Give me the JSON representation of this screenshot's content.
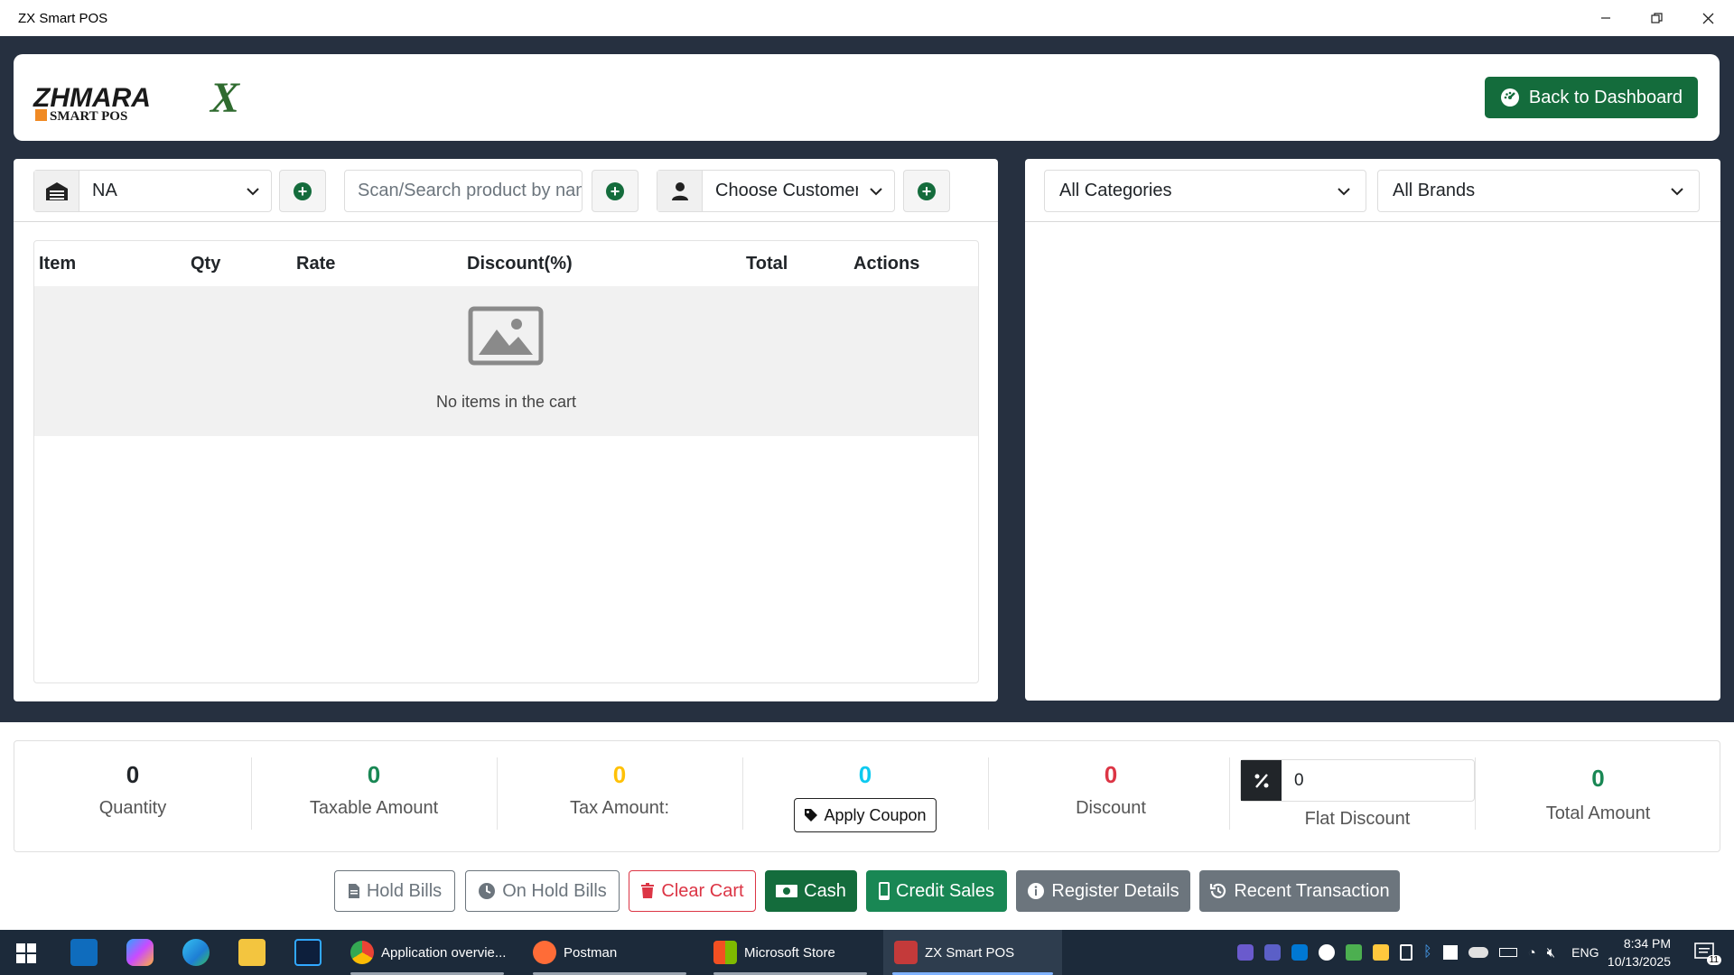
{
  "window": {
    "title": "ZX Smart POS"
  },
  "header": {
    "logo_main": "ZHMARA",
    "logo_x": "X",
    "logo_sub": "SMART POS",
    "dashboard_label": "Back to Dashboard"
  },
  "left": {
    "warehouse_value": "NA",
    "search_placeholder": "Scan/Search product by name",
    "customer_value": "Choose Customer",
    "columns": [
      "Item",
      "Qty",
      "Rate",
      "Discount(%)",
      "Total",
      "Actions"
    ],
    "empty_text": "No items in the cart"
  },
  "right": {
    "category_value": "All Categories",
    "brand_value": "All Brands"
  },
  "summary": {
    "quantity": {
      "value": "0",
      "label": "Quantity"
    },
    "taxable": {
      "value": "0",
      "label": "Taxable Amount"
    },
    "tax": {
      "value": "0",
      "label": "Tax Amount:"
    },
    "coupon": {
      "value": "0",
      "button": "Apply Coupon"
    },
    "discount": {
      "value": "0",
      "label": "Discount"
    },
    "flat": {
      "value": "0",
      "label": "Flat Discount"
    },
    "total": {
      "value": "0",
      "label": "Total Amount"
    }
  },
  "actions": {
    "hold": "Hold Bills",
    "onhold": "On Hold Bills",
    "clear": "Clear Cart",
    "cash": "Cash",
    "credit": "Credit Sales",
    "register": "Register Details",
    "recent": "Recent Transaction"
  },
  "taskbar": {
    "apps": [
      {
        "label": "Application overvie..."
      },
      {
        "label": "Postman"
      },
      {
        "label": "Microsoft Store"
      },
      {
        "label": "ZX Smart POS"
      }
    ],
    "lang": "ENG",
    "time": "8:34 PM",
    "date": "10/13/2025",
    "notif_count": "11"
  },
  "colors": {
    "brand_green": "#146c3c",
    "dark_bg": "#263040",
    "quantity": "#212529",
    "taxable": "#198754",
    "tax": "#ffc107",
    "coupon": "#0dcaf0",
    "discount": "#dc3545",
    "total": "#198754"
  }
}
